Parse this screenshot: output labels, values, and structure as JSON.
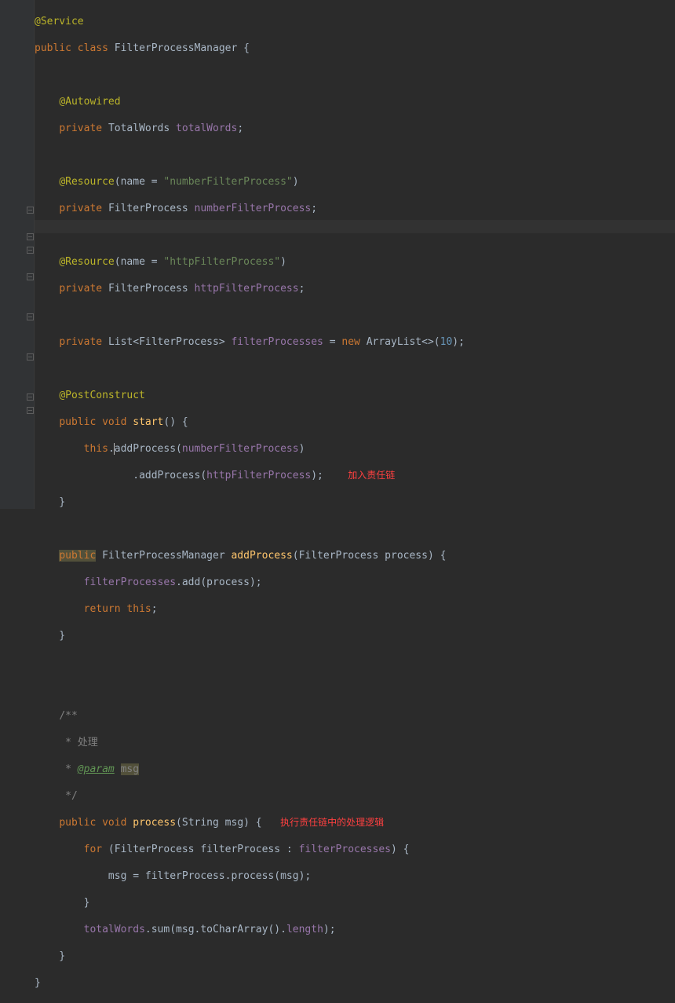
{
  "annotations": {
    "service": "@Service",
    "autowired": "@Autowired",
    "resource1_full": "@Resource(name = \"numberFilterProcess\")",
    "resource1_ann": "@Resource",
    "resource1_str": "\"numberFilterProcess\"",
    "resource2_ann": "@Resource",
    "resource2_str": "\"httpFilterProcess\"",
    "postconstruct": "@PostConstruct",
    "param_tag": "@param",
    "param_name": "msg"
  },
  "keywords": {
    "public": "public",
    "class": "class",
    "private": "private",
    "void": "void",
    "new": "new",
    "return": "return",
    "this": "this",
    "for": "for"
  },
  "identifiers": {
    "classname": "FilterProcessManager",
    "TotalWords": "TotalWords",
    "totalWords": "totalWords",
    "FilterProcess": "FilterProcess",
    "numberFilterProcess": "numberFilterProcess",
    "httpFilterProcess": "httpFilterProcess",
    "List": "List",
    "filterProcesses": "filterProcesses",
    "ArrayList": "ArrayList",
    "start": "start",
    "addProcess": "addProcess",
    "process": "process",
    "String": "String",
    "msg": "msg",
    "filterProcess": "filterProcess",
    "sum": "sum",
    "toCharArray": "toCharArray",
    "length": "length",
    "add": "add",
    "name_attr": "name"
  },
  "numbers": {
    "ten": "10"
  },
  "comments": {
    "block_open": "/**",
    "proc": " * 处理",
    "block_close": " */",
    "star": " * "
  },
  "labels_cn": {
    "add_chain": "加入责任链",
    "exec_chain": "执行责任链中的处理逻辑"
  },
  "chart_data": null
}
